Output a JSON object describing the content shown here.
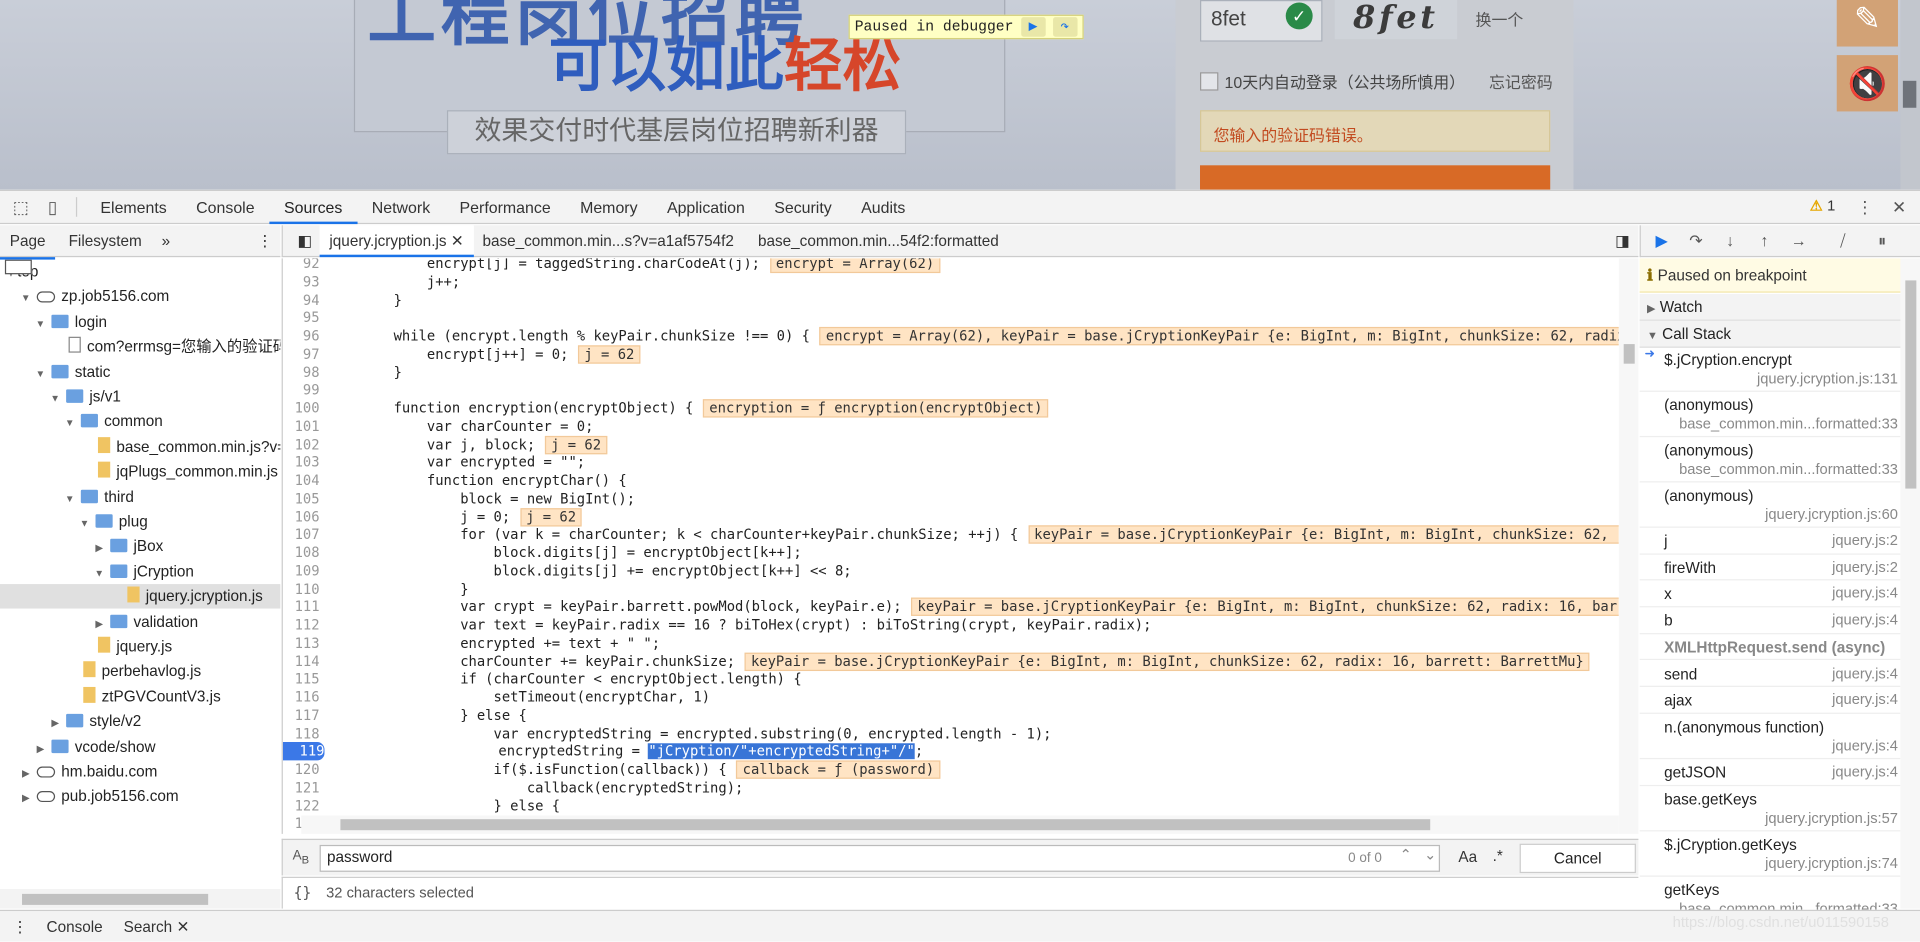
{
  "page": {
    "headline_top": "工程岗位招聘",
    "headline_main": "可以如此",
    "headline_highlight": "轻松",
    "tagline": "效果交付时代基层岗位招聘新利器",
    "captcha_value": "8fet",
    "captcha_image_text": "8fet",
    "captcha_change": "换一个",
    "remember_label": "10天内自动登录（公共场所慎用）",
    "forgot_label": "忘记密码",
    "error_text": "您输入的验证码错误。",
    "paused_label": "Paused in debugger"
  },
  "devtools": {
    "tabs": [
      "Elements",
      "Console",
      "Sources",
      "Network",
      "Performance",
      "Memory",
      "Application",
      "Security",
      "Audits"
    ],
    "active_tab": "Sources",
    "warning_count": "1"
  },
  "navigator": {
    "tabs": [
      "Page",
      "Filesystem"
    ],
    "tree": [
      {
        "label": "top",
        "depth": 0,
        "icon": "frame",
        "open": true
      },
      {
        "label": "zp.job5156.com",
        "depth": 1,
        "icon": "cloud",
        "open": true
      },
      {
        "label": "login",
        "depth": 2,
        "icon": "folder",
        "open": true
      },
      {
        "label": "com?errmsg=您输入的验证码",
        "depth": 3,
        "icon": "doc",
        "leaf": true
      },
      {
        "label": "static",
        "depth": 2,
        "icon": "folder",
        "open": true
      },
      {
        "label": "js/v1",
        "depth": 3,
        "icon": "folder",
        "open": true
      },
      {
        "label": "common",
        "depth": 4,
        "icon": "folder",
        "open": true
      },
      {
        "label": "base_common.min.js?v=",
        "depth": 5,
        "icon": "file",
        "leaf": true
      },
      {
        "label": "jqPlugs_common.min.js",
        "depth": 5,
        "icon": "file",
        "leaf": true
      },
      {
        "label": "third",
        "depth": 4,
        "icon": "folder",
        "open": true
      },
      {
        "label": "plug",
        "depth": 5,
        "icon": "folder",
        "open": true
      },
      {
        "label": "jBox",
        "depth": 6,
        "icon": "folder",
        "open": false
      },
      {
        "label": "jCryption",
        "depth": 6,
        "icon": "folder",
        "open": true
      },
      {
        "label": "jquery.jcryption.js",
        "depth": 7,
        "icon": "file",
        "leaf": true,
        "selected": true
      },
      {
        "label": "validation",
        "depth": 6,
        "icon": "folder",
        "open": false
      },
      {
        "label": "jquery.js",
        "depth": 5,
        "icon": "file",
        "leaf": true
      },
      {
        "label": "perbehavlog.js",
        "depth": 4,
        "icon": "file",
        "leaf": true
      },
      {
        "label": "ztPGVCountV3.js",
        "depth": 4,
        "icon": "file",
        "leaf": true
      },
      {
        "label": "style/v2",
        "depth": 3,
        "icon": "folder",
        "open": false
      },
      {
        "label": "vcode/show",
        "depth": 2,
        "icon": "folder",
        "open": false
      },
      {
        "label": "hm.baidu.com",
        "depth": 1,
        "icon": "cloud",
        "open": false
      },
      {
        "label": "pub.job5156.com",
        "depth": 1,
        "icon": "cloud",
        "open": false
      }
    ]
  },
  "editor": {
    "tabs": [
      "jquery.jcryption.js",
      "base_common.min...s?v=a1af5754f2",
      "base_common.min...54f2:formatted"
    ],
    "lines": [
      {
        "n": "92",
        "code": "            encrypt[j] = taggedString.charCodeAt(j);",
        "inline": "encrypt = Array(62)"
      },
      {
        "n": "93",
        "code": "            j++;",
        "inline": ""
      },
      {
        "n": "94",
        "code": "        }",
        "inline": ""
      },
      {
        "n": "95",
        "code": "",
        "inline": ""
      },
      {
        "n": "96",
        "code": "        while (encrypt.length % keyPair.chunkSize !== 0) {",
        "inline": "encrypt = Array(62), keyPair = base.jCryptionKeyPair {e: BigInt, m: BigInt, chunkSize: 62, radix"
      },
      {
        "n": "97",
        "code": "            encrypt[j++] = 0;",
        "inline": "j = 62"
      },
      {
        "n": "98",
        "code": "        }",
        "inline": ""
      },
      {
        "n": "99",
        "code": "",
        "inline": ""
      },
      {
        "n": "100",
        "code": "        function encryption(encryptObject) {",
        "inline": "encryption = ƒ encryption(encryptObject)"
      },
      {
        "n": "101",
        "code": "            var charCounter = 0;",
        "inline": ""
      },
      {
        "n": "102",
        "code": "            var j, block;",
        "inline": "j = 62"
      },
      {
        "n": "103",
        "code": "            var encrypted = \"\";",
        "inline": ""
      },
      {
        "n": "104",
        "code": "            function encryptChar() {",
        "inline": ""
      },
      {
        "n": "105",
        "code": "                block = new BigInt();",
        "inline": ""
      },
      {
        "n": "106",
        "code": "                j = 0;",
        "inline": "j = 62"
      },
      {
        "n": "107",
        "code": "                for (var k = charCounter; k < charCounter+keyPair.chunkSize; ++j) {",
        "inline": "keyPair = base.jCryptionKeyPair {e: BigInt, m: BigInt, chunkSize: 62, ra"
      },
      {
        "n": "108",
        "code": "                    block.digits[j] = encryptObject[k++];",
        "inline": ""
      },
      {
        "n": "109",
        "code": "                    block.digits[j] += encryptObject[k++] << 8;",
        "inline": ""
      },
      {
        "n": "110",
        "code": "                }",
        "inline": ""
      },
      {
        "n": "111",
        "code": "                var crypt = keyPair.barrett.powMod(block, keyPair.e);",
        "inline": "keyPair = base.jCryptionKeyPair {e: BigInt, m: BigInt, chunkSize: 62, radix: 16, barre"
      },
      {
        "n": "112",
        "code": "                var text = keyPair.radix == 16 ? biToHex(crypt) : biToString(crypt, keyPair.radix);",
        "inline": ""
      },
      {
        "n": "113",
        "code": "                encrypted += text + \" \";",
        "inline": ""
      },
      {
        "n": "114",
        "code": "                charCounter += keyPair.chunkSize;",
        "inline": "keyPair = base.jCryptionKeyPair {e: BigInt, m: BigInt, chunkSize: 62, radix: 16, barrett: BarrettMu}"
      },
      {
        "n": "115",
        "code": "                if (charCounter < encryptObject.length) {",
        "inline": ""
      },
      {
        "n": "116",
        "code": "                    setTimeout(encryptChar, 1)",
        "inline": ""
      },
      {
        "n": "117",
        "code": "                } else {",
        "inline": ""
      },
      {
        "n": "118",
        "code": "                    var encryptedString = encrypted.substring(0, encrypted.length - 1);",
        "inline": ""
      },
      {
        "n": "119",
        "code": "                    encryptedString = ",
        "selected": "\"jCryption/\"+encryptedString+\"/\"",
        "tail": ";",
        "inline": "",
        "breakpoint": true
      },
      {
        "n": "120",
        "code": "                    if($.isFunction(callback)) {",
        "inline": "callback = ƒ (password)"
      },
      {
        "n": "121",
        "code": "                        callback(encryptedString);",
        "inline": ""
      },
      {
        "n": "122",
        "code": "                    } else {",
        "inline": ""
      },
      {
        "n": "123",
        "code": "",
        "inline": ""
      }
    ],
    "search_value": "password",
    "search_count": "0 of 0",
    "match_case": "Aa",
    "regex": ".*",
    "cancel_label": "Cancel",
    "status": "32 characters selected",
    "format_icon": "{}"
  },
  "debugger": {
    "paused_text": "Paused on breakpoint",
    "watch_label": "Watch",
    "callstack_label": "Call Stack",
    "frames": [
      {
        "name": "$.jCryption.encrypt",
        "loc": "jquery.jcryption.js:131",
        "current": true,
        "two_line": true
      },
      {
        "name": "(anonymous)",
        "loc": "base_common.min...formatted:33",
        "two_line": true
      },
      {
        "name": "(anonymous)",
        "loc": "base_common.min...formatted:33",
        "two_line": true
      },
      {
        "name": "(anonymous)",
        "loc": "jquery.jcryption.js:60",
        "two_line": true
      },
      {
        "name": "j",
        "loc": "jquery.js:2"
      },
      {
        "name": "fireWith",
        "loc": "jquery.js:2"
      },
      {
        "name": "x",
        "loc": "jquery.js:4"
      },
      {
        "name": "b",
        "loc": "jquery.js:4"
      },
      {
        "name": "XMLHttpRequest.send (async)",
        "loc": "",
        "async": true
      },
      {
        "name": "send",
        "loc": "jquery.js:4"
      },
      {
        "name": "ajax",
        "loc": "jquery.js:4"
      },
      {
        "name": "n.(anonymous function)",
        "loc": "jquery.js:4",
        "two_line": true
      },
      {
        "name": "getJSON",
        "loc": "jquery.js:4"
      },
      {
        "name": "base.getKeys",
        "loc": "jquery.jcryption.js:57",
        "two_line": true
      },
      {
        "name": "$.jCryption.getKeys",
        "loc": "jquery.jcryption.js:74",
        "two_line": true
      },
      {
        "name": "getKeys",
        "loc": "base_common.min...formatted:33",
        "two_line": true
      }
    ]
  },
  "drawer": {
    "tabs": [
      "Console",
      "Search"
    ],
    "watermark": "https://blog.csdn.net/u011590158"
  }
}
